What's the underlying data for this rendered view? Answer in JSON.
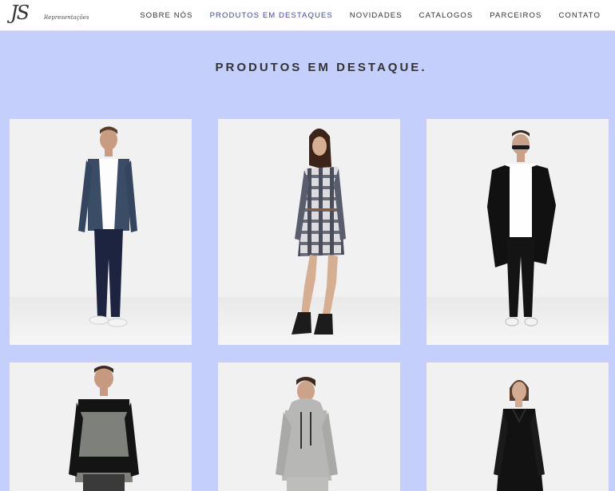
{
  "header": {
    "logo_text": "JS",
    "logo_subtext": "Representações",
    "nav": [
      {
        "label": "SOBRE NÓS",
        "active": false
      },
      {
        "label": "PRODUTOS EM DESTAQUES",
        "active": true
      },
      {
        "label": "NOVIDADES",
        "active": false
      },
      {
        "label": "CATALOGOS",
        "active": false
      },
      {
        "label": "PARCEIROS",
        "active": false
      },
      {
        "label": "CONTATO",
        "active": false
      }
    ]
  },
  "main": {
    "title": "PRODUTOS EM DESTAQUE."
  },
  "colors": {
    "page_background": "#c4cffb",
    "nav_active": "#3c44b8",
    "nav_text": "#333333"
  },
  "products": [
    {
      "image": "man-denim-jacket"
    },
    {
      "image": "woman-plaid-shirt-dress"
    },
    {
      "image": "man-black-drape-cardigan"
    },
    {
      "image": "man-striped-sweater"
    },
    {
      "image": "man-grey-hoodie"
    },
    {
      "image": "woman-black-shirt-dress"
    }
  ]
}
